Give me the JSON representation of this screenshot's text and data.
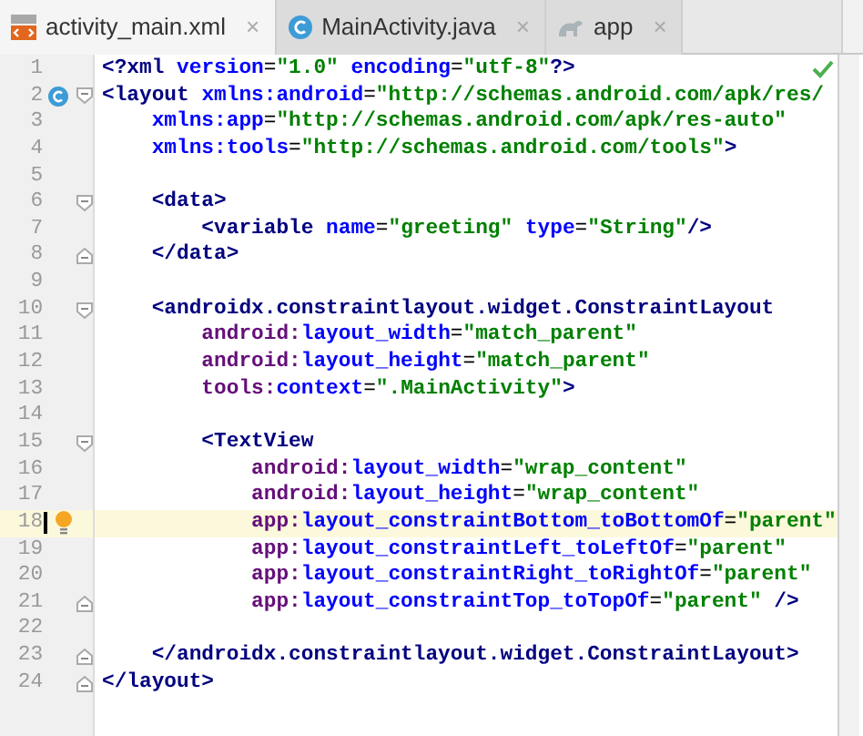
{
  "tabs": [
    {
      "label": "activity_main.xml",
      "kind": "xml",
      "close": "×",
      "selected": true
    },
    {
      "label": "MainActivity.java",
      "kind": "class",
      "close": "×",
      "selected": false
    },
    {
      "label": "app",
      "kind": "gradle",
      "close": "×",
      "selected": false
    }
  ],
  "editor": {
    "lines": [
      {
        "number": "1",
        "tokens": [
          {
            "kind": "tag",
            "text": "<?xml"
          },
          {
            "kind": "attr",
            "text": " version"
          },
          {
            "kind": "punct",
            "text": "="
          },
          {
            "kind": "value",
            "text": "\"1.0\""
          },
          {
            "kind": "attr",
            "text": " encoding"
          },
          {
            "kind": "punct",
            "text": "="
          },
          {
            "kind": "value",
            "text": "\"utf-8\""
          },
          {
            "kind": "tag",
            "text": "?>"
          }
        ]
      },
      {
        "number": "2",
        "gutter": [
          {
            "kind": "class"
          },
          {
            "kind": "fold-start"
          }
        ],
        "tokens": [
          {
            "kind": "tag",
            "text": "<layout"
          },
          {
            "kind": "attr",
            "text": " xmlns:android"
          },
          {
            "kind": "punct",
            "text": "="
          },
          {
            "kind": "value",
            "text": "\"http://schemas.android.com/apk/res/"
          }
        ]
      },
      {
        "number": "3",
        "tokens": [
          {
            "kind": "attr",
            "text": "    xmlns:app"
          },
          {
            "kind": "punct",
            "text": "="
          },
          {
            "kind": "value",
            "text": "\"http://schemas.android.com/apk/res-auto\""
          }
        ]
      },
      {
        "number": "4",
        "tokens": [
          {
            "kind": "attr",
            "text": "    xmlns:tools"
          },
          {
            "kind": "punct",
            "text": "="
          },
          {
            "kind": "value",
            "text": "\"http://schemas.android.com/tools\""
          },
          {
            "kind": "tag",
            "text": ">"
          }
        ]
      },
      {
        "number": "5"
      },
      {
        "number": "6",
        "gutter": [
          {
            "kind": "fold-start"
          }
        ],
        "tokens": [
          {
            "kind": "tag",
            "text": "    <data>"
          }
        ]
      },
      {
        "number": "7",
        "tokens": [
          {
            "kind": "tag",
            "text": "        <variable"
          },
          {
            "kind": "attr",
            "text": " name"
          },
          {
            "kind": "punct",
            "text": "="
          },
          {
            "kind": "value",
            "text": "\"greeting\""
          },
          {
            "kind": "attr",
            "text": " type"
          },
          {
            "kind": "punct",
            "text": "="
          },
          {
            "kind": "value",
            "text": "\"String\""
          },
          {
            "kind": "tag",
            "text": "/>"
          }
        ]
      },
      {
        "number": "8",
        "gutter": [
          {
            "kind": "fold-end"
          }
        ],
        "tokens": [
          {
            "kind": "tag",
            "text": "    </data>"
          }
        ]
      },
      {
        "number": "9"
      },
      {
        "number": "10",
        "gutter": [
          {
            "kind": "fold-start"
          }
        ],
        "tokens": [
          {
            "kind": "tag",
            "text": "    <androidx.constraintlayout.widget.ConstraintLayout"
          }
        ]
      },
      {
        "number": "11",
        "tokens": [
          {
            "kind": "ns",
            "text": "        android:"
          },
          {
            "kind": "attr",
            "text": "layout_width"
          },
          {
            "kind": "punct",
            "text": "="
          },
          {
            "kind": "value",
            "text": "\"match_parent\""
          }
        ]
      },
      {
        "number": "12",
        "tokens": [
          {
            "kind": "ns",
            "text": "        android:"
          },
          {
            "kind": "attr",
            "text": "layout_height"
          },
          {
            "kind": "punct",
            "text": "="
          },
          {
            "kind": "value",
            "text": "\"match_parent\""
          }
        ]
      },
      {
        "number": "13",
        "tokens": [
          {
            "kind": "ns",
            "text": "        tools:"
          },
          {
            "kind": "attr",
            "text": "context"
          },
          {
            "kind": "punct",
            "text": "="
          },
          {
            "kind": "value",
            "text": "\".MainActivity\""
          },
          {
            "kind": "tag",
            "text": ">"
          }
        ]
      },
      {
        "number": "14"
      },
      {
        "number": "15",
        "gutter": [
          {
            "kind": "fold-start"
          }
        ],
        "tokens": [
          {
            "kind": "tag",
            "text": "        <TextView"
          }
        ]
      },
      {
        "number": "16",
        "tokens": [
          {
            "kind": "ns",
            "text": "            android:"
          },
          {
            "kind": "attr",
            "text": "layout_width"
          },
          {
            "kind": "punct",
            "text": "="
          },
          {
            "kind": "value",
            "text": "\"wrap_content\""
          }
        ]
      },
      {
        "number": "17",
        "tokens": [
          {
            "kind": "ns",
            "text": "            android:"
          },
          {
            "kind": "attr",
            "text": "layout_height"
          },
          {
            "kind": "punct",
            "text": "="
          },
          {
            "kind": "value",
            "text": "\"wrap_content\""
          }
        ]
      },
      {
        "number": "18",
        "current": true,
        "gutter": [
          {
            "kind": "bulb"
          }
        ],
        "tokens": [
          {
            "kind": "ns",
            "text": "            app:"
          },
          {
            "kind": "attr",
            "text": "layout_constraintBottom_toBottomOf"
          },
          {
            "kind": "punct",
            "text": "="
          },
          {
            "kind": "value",
            "text": "\"parent\""
          }
        ]
      },
      {
        "number": "19",
        "tokens": [
          {
            "kind": "ns",
            "text": "            app:"
          },
          {
            "kind": "attr",
            "text": "layout_constraintLeft_toLeftOf"
          },
          {
            "kind": "punct",
            "text": "="
          },
          {
            "kind": "value",
            "text": "\"parent\""
          }
        ]
      },
      {
        "number": "20",
        "tokens": [
          {
            "kind": "ns",
            "text": "            app:"
          },
          {
            "kind": "attr",
            "text": "layout_constraintRight_toRightOf"
          },
          {
            "kind": "punct",
            "text": "="
          },
          {
            "kind": "value",
            "text": "\"parent\""
          }
        ]
      },
      {
        "number": "21",
        "gutter": [
          {
            "kind": "fold-end"
          }
        ],
        "tokens": [
          {
            "kind": "ns",
            "text": "            app:"
          },
          {
            "kind": "attr",
            "text": "layout_constraintTop_toTopOf"
          },
          {
            "kind": "punct",
            "text": "="
          },
          {
            "kind": "value",
            "text": "\"parent\""
          },
          {
            "kind": "tag",
            "text": " />"
          }
        ]
      },
      {
        "number": "22"
      },
      {
        "number": "23",
        "gutter": [
          {
            "kind": "fold-end"
          }
        ],
        "tokens": [
          {
            "kind": "tag",
            "text": "    </androidx.constraintlayout.widget.ConstraintLayout>"
          }
        ]
      },
      {
        "number": "24",
        "gutter": [
          {
            "kind": "fold-end"
          }
        ],
        "tokens": [
          {
            "kind": "tag",
            "text": "</layout>"
          }
        ]
      }
    ]
  }
}
